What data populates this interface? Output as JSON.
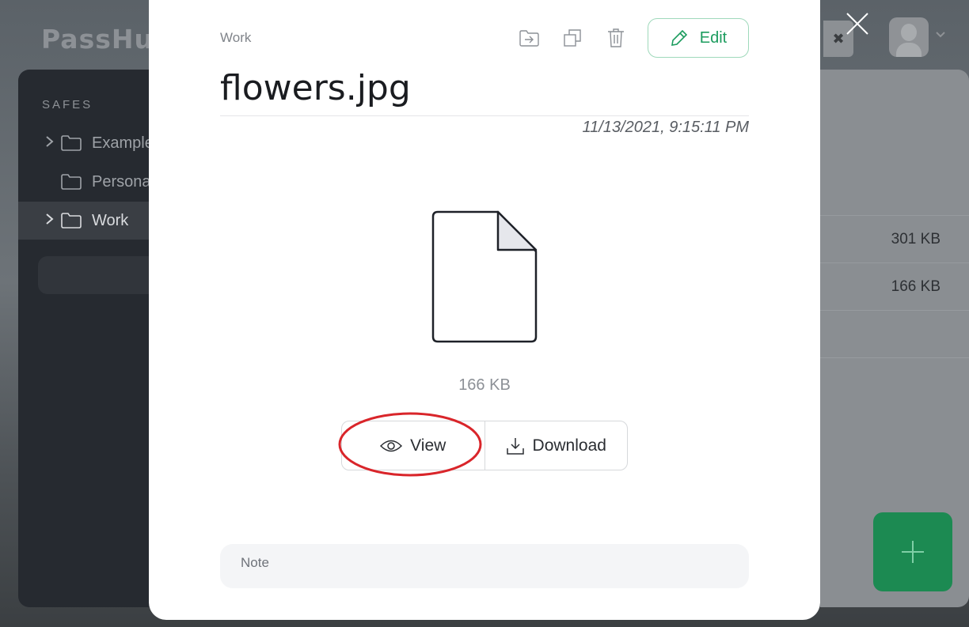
{
  "app": {
    "logo": "PassHub"
  },
  "sidebar": {
    "heading": "SAFES",
    "safes": [
      {
        "label": "Examples",
        "expandable": true,
        "active": false
      },
      {
        "label": "Personal",
        "expandable": false,
        "active": false
      },
      {
        "label": "Work",
        "expandable": true,
        "active": true
      }
    ]
  },
  "background_list": {
    "rows": [
      {
        "size": "301 KB"
      },
      {
        "size": "166 KB"
      }
    ]
  },
  "modal": {
    "safe_name": "Work",
    "title": "flowers.jpg",
    "timestamp": "11/13/2021, 9:15:11 PM",
    "file_size": "166 KB",
    "edit_label": "Edit",
    "view_label": "View",
    "download_label": "Download",
    "note_placeholder": "Note",
    "icons": [
      "move-icon",
      "copy-icon",
      "trash-icon",
      "pencil-icon",
      "eye-icon",
      "download-icon",
      "file-icon",
      "close-icon"
    ]
  },
  "colors": {
    "accent_green": "#1c9c5e",
    "fab_green": "#1c8a52",
    "highlight_red": "#d9252a",
    "sidebar_bg": "#262a30"
  }
}
